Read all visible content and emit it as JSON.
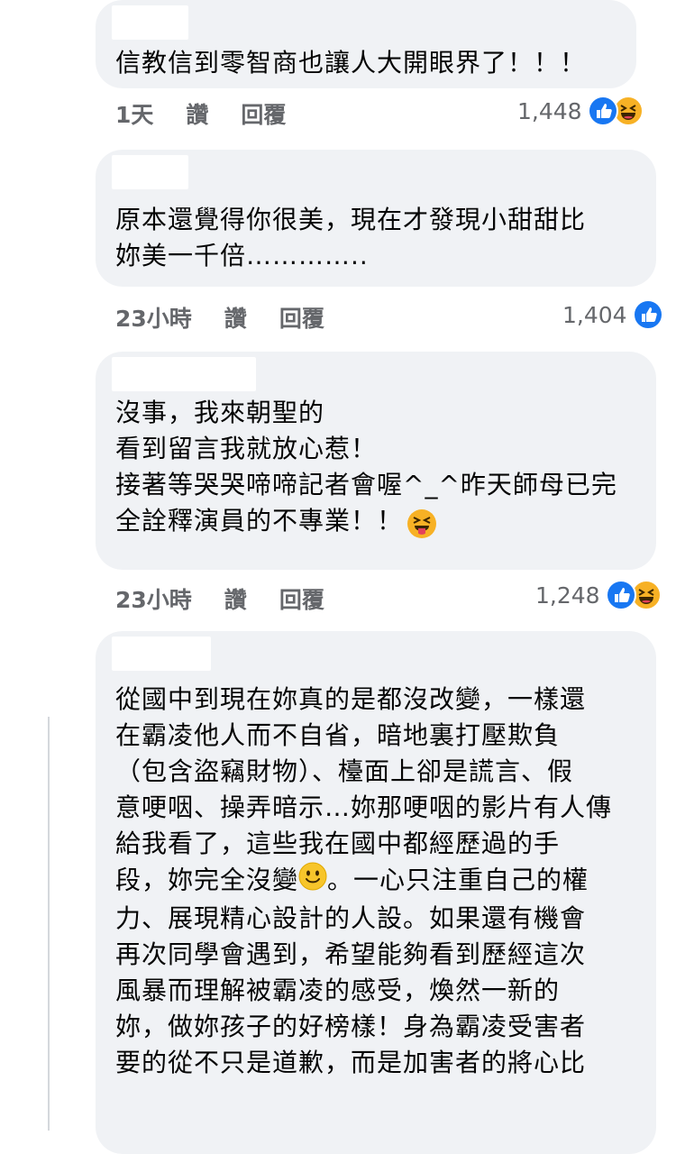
{
  "comments": [
    {
      "text": "信教信到零智商也讓人大開眼界了！！！",
      "time": "1天",
      "like_label": "讚",
      "reply_label": "回覆",
      "reaction_count": "1,448",
      "reactions": [
        "like",
        "haha"
      ]
    },
    {
      "text": "原本還覺得你很美，現在才發現小甜甜比\n妳美一千倍…………..",
      "time": "23小時",
      "like_label": "讚",
      "reply_label": "回覆",
      "reaction_count": "1,404",
      "reactions": [
        "like"
      ]
    },
    {
      "text": "沒事，我來朝聖的\n看到留言我就放心惹！\n接著等哭哭啼啼記者會喔^_^昨天師母已完\n全詮釋演員的不專業！！",
      "emoji": "squinting-tongue-face",
      "time": "23小時",
      "like_label": "讚",
      "reply_label": "回覆",
      "reaction_count": "1,248",
      "reactions": [
        "like",
        "haha"
      ]
    },
    {
      "text_before_emoji": "從國中到現在妳真的是都沒改變，一樣還\n在霸凌他人而不自省，暗地裏打壓欺負\n（包含盜竊財物）、檯面上卻是謊言、假\n意哽咽、操弄暗示…妳那哽咽的影片有人傳\n給我看了，這些我在國中都經歷過的手\n段，妳完全沒變",
      "emoji": "slightly-smiling-face",
      "text_after_emoji": "。一心只注重自己的權\n力、展現精心設計的人設。如果還有機會\n再次同學會遇到，希望能夠看到歷經這次\n風暴而理解被霸凌的感受，煥然一新的\n妳，做妳孩子的好榜樣！身為霸凌受害者\n要的從不只是道歉，而是加害者的將心比"
    }
  ],
  "colors": {
    "bubble": "#f0f2f5",
    "meta_text": "#65676b",
    "like_blue": "#1877f2",
    "haha_yellow": "#f7b125"
  }
}
